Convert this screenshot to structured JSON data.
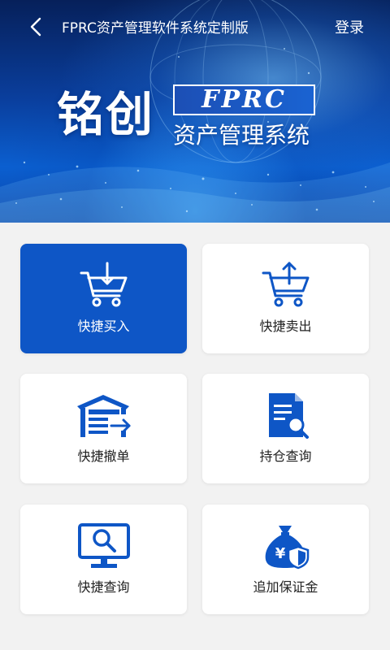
{
  "header": {
    "title": "FPRC资产管理软件系统定制版",
    "login_label": "登录"
  },
  "banner": {
    "brand_main": "铭创",
    "brand_tag": "FPRC",
    "brand_sub": "资产管理系统"
  },
  "tiles": [
    {
      "label": "快捷买入",
      "icon": "cart-download-icon"
    },
    {
      "label": "快捷卖出",
      "icon": "cart-upload-icon"
    },
    {
      "label": "快捷撤单",
      "icon": "warehouse-exit-icon"
    },
    {
      "label": "持仓查询",
      "icon": "document-search-icon"
    },
    {
      "label": "快捷查询",
      "icon": "monitor-search-icon"
    },
    {
      "label": "追加保证金",
      "icon": "money-bag-shield-icon"
    }
  ],
  "colors": {
    "accent": "#0e56c6",
    "icon_blue": "#0e56c6",
    "page_bg": "#f2f2f2"
  }
}
